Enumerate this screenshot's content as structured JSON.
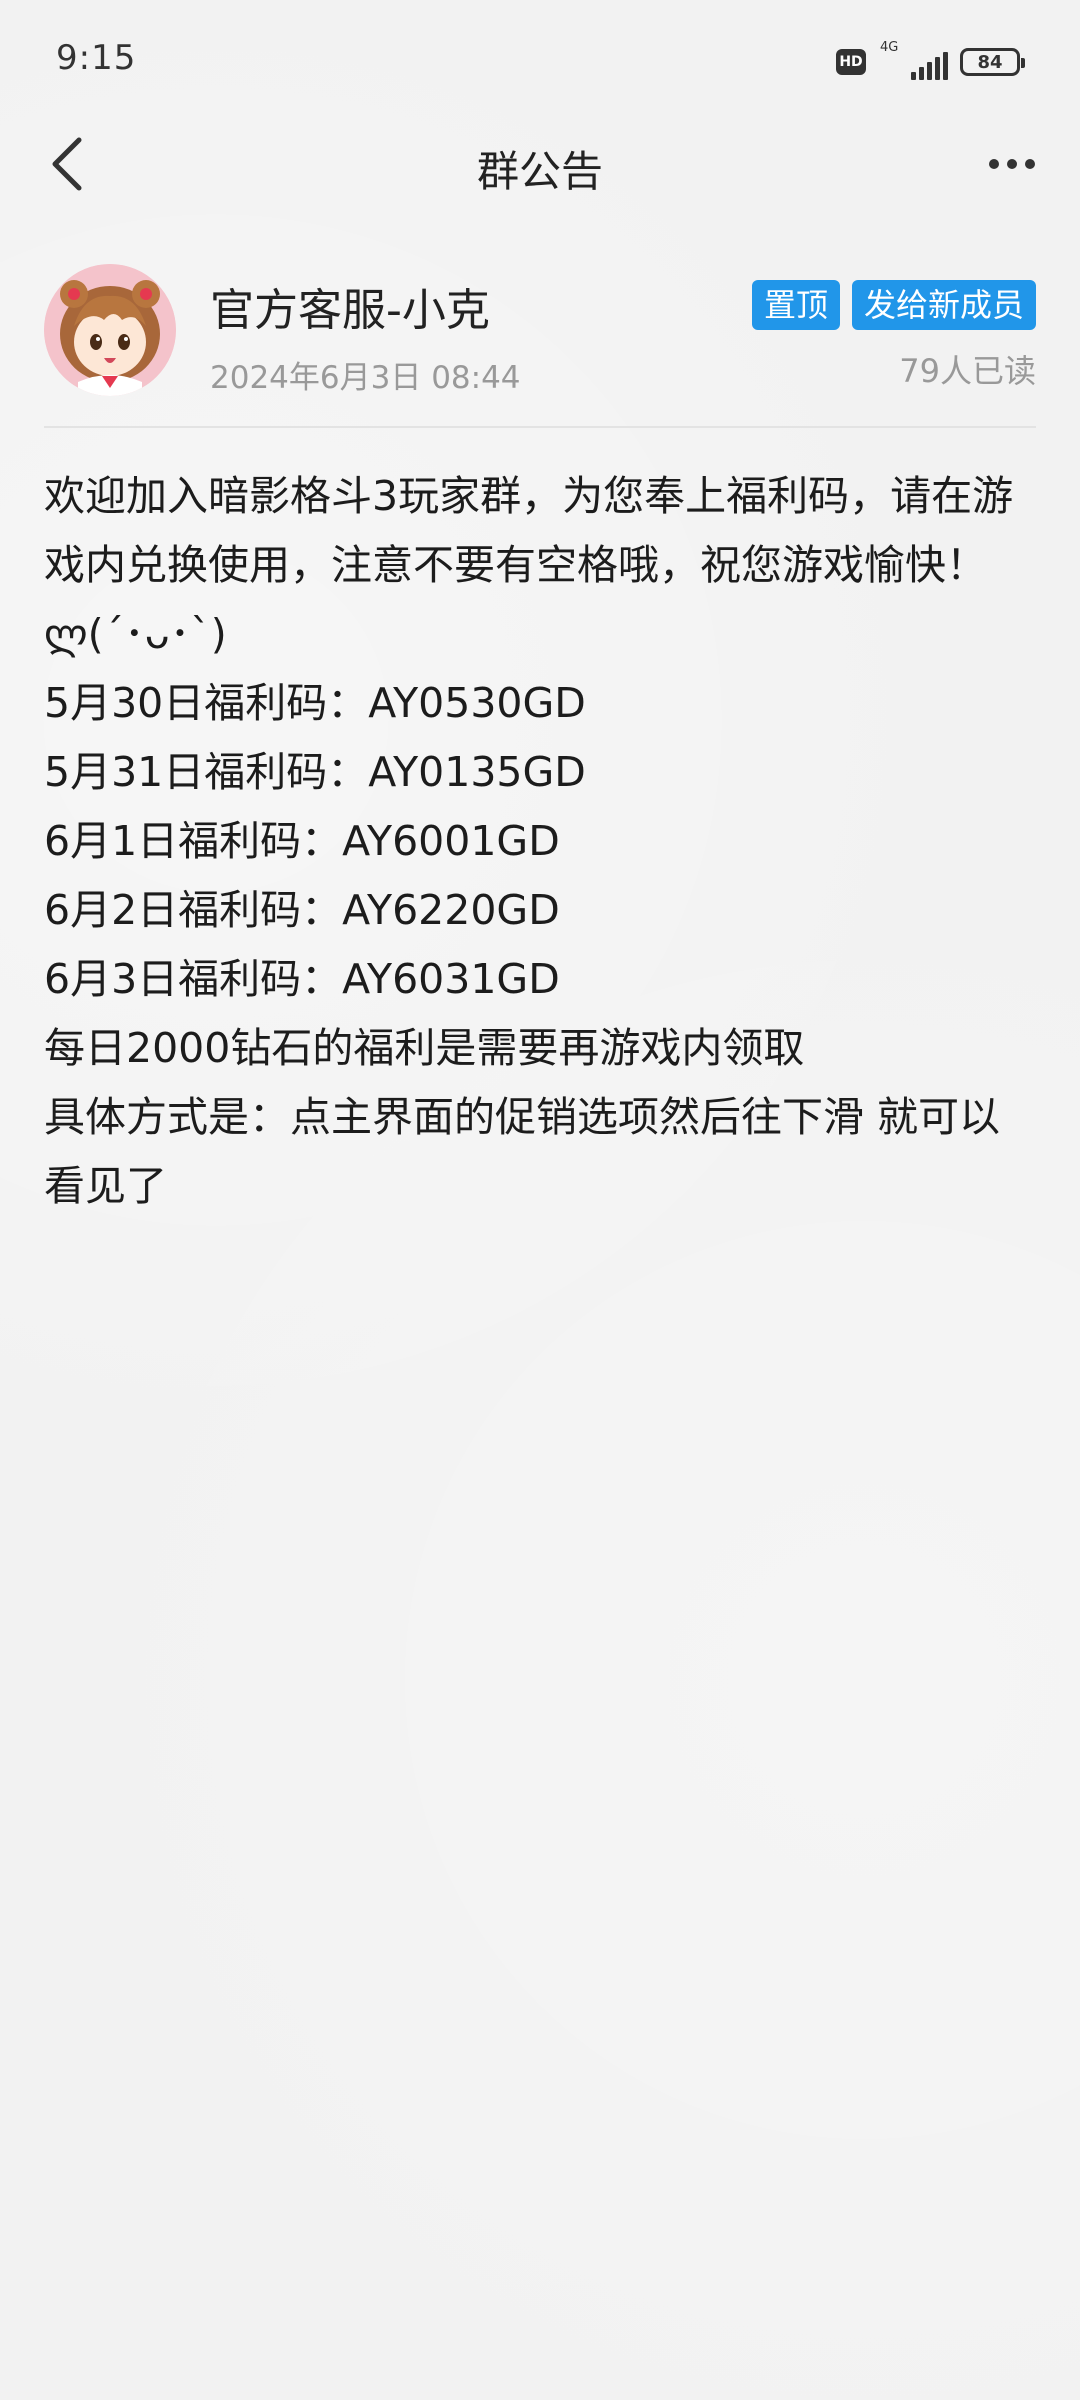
{
  "status_bar": {
    "time": "9:15",
    "hd": "HD",
    "network": "4G",
    "battery": "84"
  },
  "header": {
    "title": "群公告"
  },
  "author": {
    "name": "官方客服-小克",
    "time": "2024年6月3日 08:44",
    "tags": [
      "置顶",
      "发给新成员"
    ],
    "read_count": "79人已读"
  },
  "content": {
    "paragraphs": [
      "欢迎加入暗影格斗3玩家群，为您奉上福利码，请在游戏内兑换使用，注意不要有空格哦，祝您游戏愉快！ლ(´･ᴗ･`)",
      "5月30日福利码：AY0530GD",
      "5月31日福利码：AY0135GD",
      "6月1日福利码：AY6001GD",
      "6月2日福利码：AY6220GD",
      "6月3日福利码：AY6031GD",
      "每日2000钻石的福利是需要再游戏内领取",
      "具体方式是：点主界面的促销选项然后往下滑 就可以看见了"
    ]
  },
  "icons": {
    "back": "back-chevron-icon",
    "more": "more-dots-icon",
    "signal": "signal-icon",
    "battery": "battery-icon",
    "avatar": "anime-girl-avatar"
  },
  "colors": {
    "tag_blue": "#2196e9",
    "muted_text": "#999999",
    "background": "#f2f2f2"
  }
}
